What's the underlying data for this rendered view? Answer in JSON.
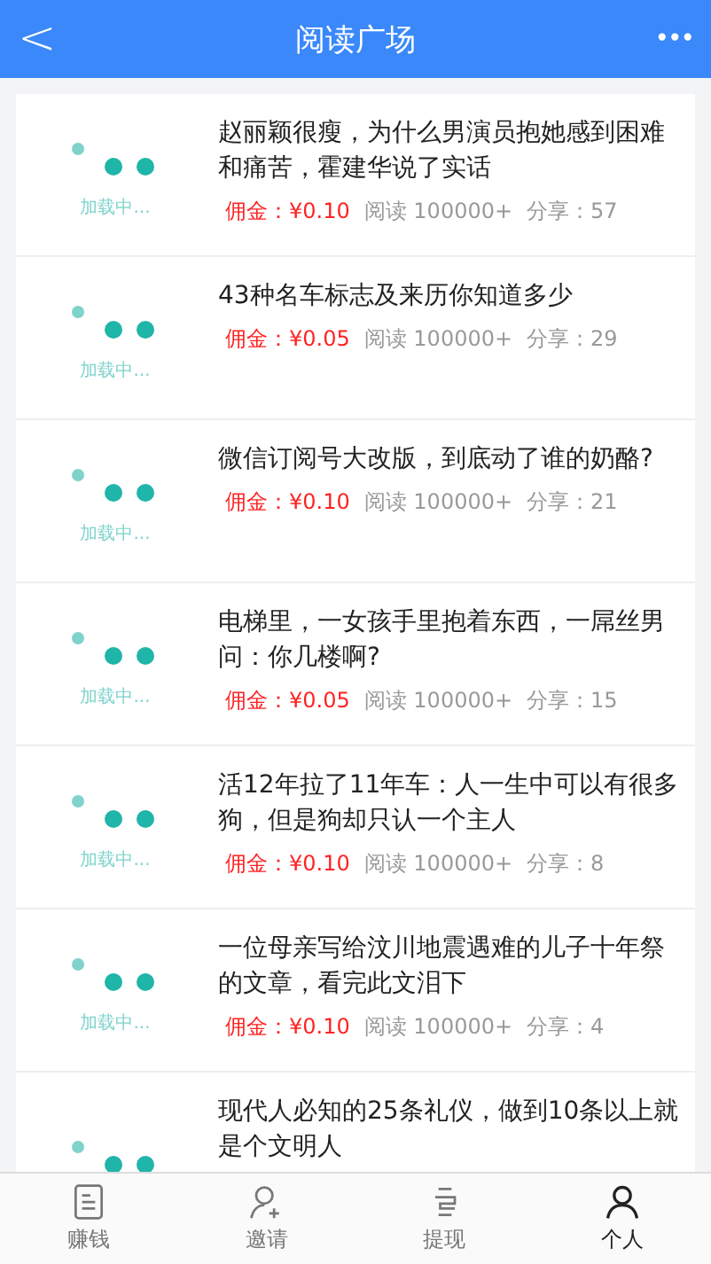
{
  "header": {
    "back": "<",
    "title": "阅读广场",
    "more": "•••"
  },
  "articles": [
    {
      "title": "赵丽颖很瘦，为什么男演员抱她感到困难和痛苦，霍建华说了实话",
      "loader": "加载中...",
      "commission": "佣金：¥0.10",
      "reads": "阅读 100000+",
      "shares": "分享：57"
    },
    {
      "title": "43种名车标志及来历你知道多少",
      "loader": "加载中...",
      "commission": "佣金：¥0.05",
      "reads": "阅读 100000+",
      "shares": "分享：29"
    },
    {
      "title": "微信订阅号大改版，到底动了谁的奶酪?",
      "loader": "加载中...",
      "commission": "佣金：¥0.10",
      "reads": "阅读 100000+",
      "shares": "分享：21"
    },
    {
      "title": "电梯里，一女孩手里抱着东西，一屌丝男问：你几楼啊?",
      "loader": "加载中...",
      "commission": "佣金：¥0.05",
      "reads": "阅读 100000+",
      "shares": "分享：15"
    },
    {
      "title": "活12年拉了11年车：人一生中可以有很多狗，但是狗却只认一个主人",
      "loader": "加载中...",
      "commission": "佣金：¥0.10",
      "reads": "阅读 100000+",
      "shares": "分享：8"
    },
    {
      "title": "一位母亲写给汶川地震遇难的儿子十年祭的文章，看完此文泪下",
      "loader": "加载中...",
      "commission": "佣金：¥0.10",
      "reads": "阅读 100000+",
      "shares": "分享：4"
    },
    {
      "title": "现代人必知的25条礼仪，做到10条以上就是个文明人"
    }
  ],
  "tabs": [
    {
      "kind": "doc",
      "label": "赚钱",
      "selected": false
    },
    {
      "kind": "invite",
      "label": "邀请",
      "selected": false
    },
    {
      "kind": "withdraw",
      "label": "提现",
      "selected": false
    },
    {
      "kind": "person",
      "label": "个人",
      "selected": true
    }
  ]
}
